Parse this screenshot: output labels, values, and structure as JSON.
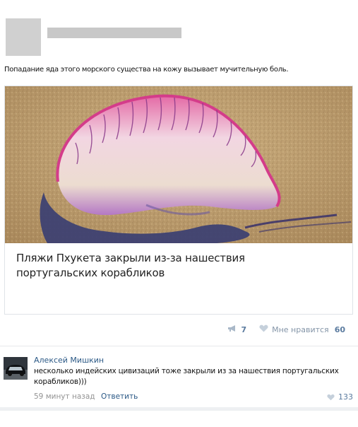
{
  "post": {
    "text": "Попадание яда этого морского существа на кожу вызывает мучительную боль."
  },
  "card": {
    "title": "Пляжи Пхукета закрыли из-за нашествия португальских корабликов"
  },
  "actions": {
    "shares": "7",
    "like_label": "Мне нравится",
    "likes": "60"
  },
  "comment": {
    "author": "Алексей Мишкин",
    "text": "несколько индейских цивизаций тоже закрыли из за нашествия португальских корабликов)))",
    "time": "59 минут назад",
    "reply": "Ответить",
    "likes": "133"
  },
  "colors": {
    "link": "#2a5885",
    "meta": "#939393",
    "accent": "#5b7b9f"
  }
}
